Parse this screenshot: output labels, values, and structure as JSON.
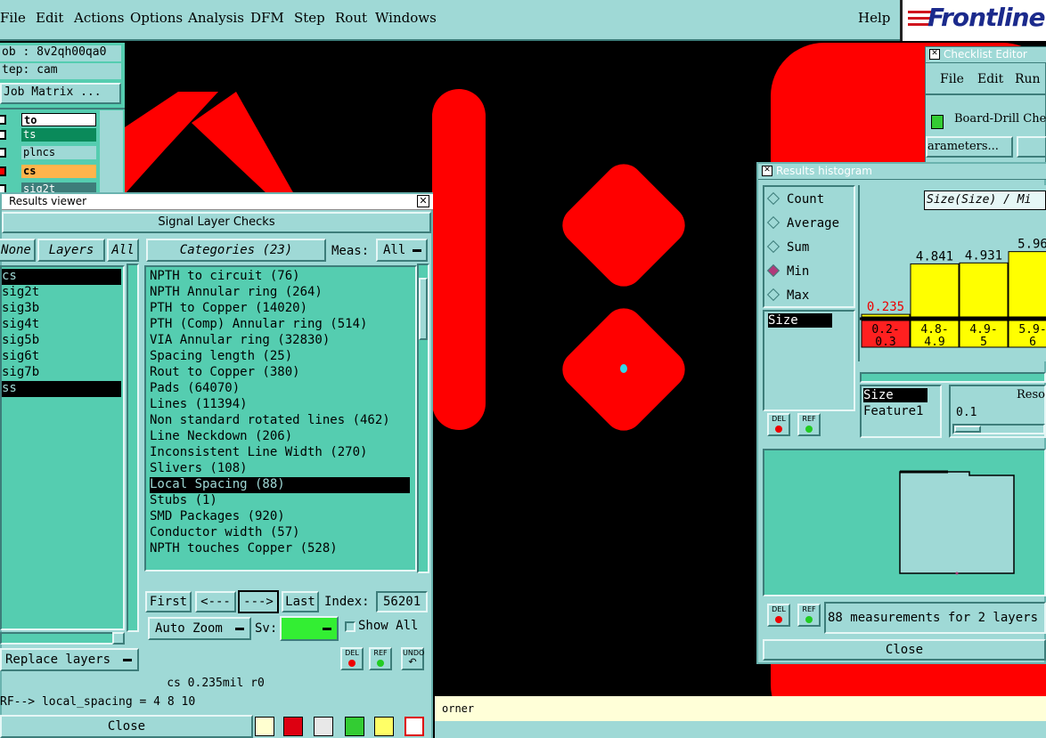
{
  "menubar": {
    "items": [
      "File",
      "Edit",
      "Actions",
      "Options",
      "Analysis",
      "DFM",
      "Step",
      "Rout",
      "Windows"
    ],
    "help": "Help",
    "logo": "Frontline"
  },
  "leftstrip": {
    "job": "ob : 8v2qh00qa0",
    "step": "tep: cam",
    "matrix": "Job Matrix ...",
    "layers": [
      "to",
      "ts",
      "plncs",
      "cs",
      "sig2t"
    ]
  },
  "results_viewer": {
    "title": "Results viewer",
    "heading": "Signal Layer Checks",
    "none_label": "None",
    "layers_label": "Layers",
    "all_label": "All",
    "categories_label": "Categories (23)",
    "meas_label": "Meas:",
    "meas_value": "All",
    "layer_list": [
      "cs",
      "sig2t",
      "sig3b",
      "sig4t",
      "sig5b",
      "sig6t",
      "sig7b",
      "ss"
    ],
    "categories": [
      "NPTH to circuit (76)",
      "NPTH Annular ring (264)",
      "PTH to Copper (14020)",
      "PTH (Comp) Annular ring (514)",
      "VIA Annular ring (32830)",
      "Spacing length (25)",
      "Rout to Copper (380)",
      "Pads (64070)",
      "Lines (11394)",
      "Non standard rotated lines (462)",
      "Line Neckdown (206)",
      "Inconsistent Line Width (270)",
      "Slivers (108)",
      "Local Spacing (88)",
      "Stubs (1)",
      "SMD Packages (920)",
      "Conductor width (57)",
      "NPTH touches Copper (528)"
    ],
    "selected_category": "Local Spacing (88)",
    "first": "First",
    "prev": "<---",
    "next": "--->",
    "last": "Last",
    "index_label": "Index:",
    "index_value": "56201",
    "auto_zoom": "Auto Zoom",
    "sv_label": "Sv:",
    "show_all": "Show All",
    "replace_layers": "Replace layers",
    "del": "DEL",
    "ref": "REF",
    "undo": "UNDO",
    "info": "cs 0.235mil  r0",
    "ref_line": "RF--> local_spacing = 4 8 10",
    "close": "Close"
  },
  "status_text": "orner",
  "checklist_editor": {
    "title": "Checklist Editor",
    "menu": [
      "File",
      "Edit",
      "Run"
    ],
    "item": "Board-Drill Che",
    "params": "arameters..."
  },
  "histogram": {
    "title": "Results histogram",
    "radios": [
      "Count",
      "Average",
      "Sum",
      "Min",
      "Max"
    ],
    "selected_radio": "Min",
    "chart_title": "Size(Size) / Mi",
    "list_label": "Size",
    "bars": [
      {
        "label": "0.235",
        "bin": "0.2-0.3",
        "value": 0.235
      },
      {
        "label": "4.841",
        "bin": "4.8-4.9",
        "value": 4.841
      },
      {
        "label": "4.931",
        "bin": "4.9-5",
        "value": 4.931
      },
      {
        "label": "5.96",
        "bin": "5.9-6",
        "value": 5.96
      }
    ],
    "attr_list": [
      "Size",
      "Feature1"
    ],
    "reso_label": "Reso",
    "reso_value": "0.1",
    "summary": "88 measurements for 2 layers",
    "close": "Close",
    "del": "DEL",
    "ref": "REF"
  },
  "colors": {
    "panel": "#9fd9d6",
    "list": "#55cdb0",
    "copper": "#ff0000",
    "accent": "#1b2a8c"
  }
}
